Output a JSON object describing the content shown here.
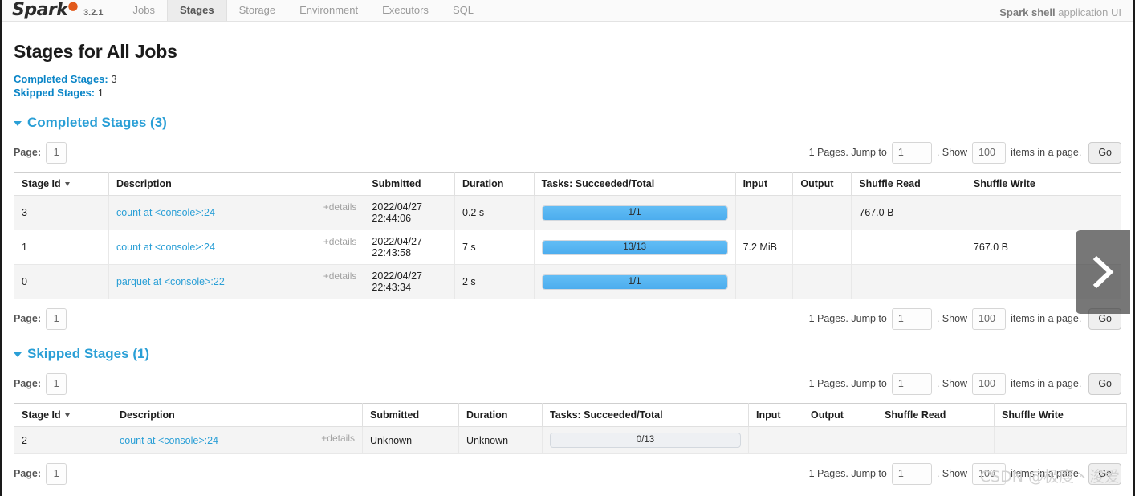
{
  "navbar": {
    "logo_text": "Spark",
    "version": "3.2.1",
    "tabs": [
      {
        "label": "Jobs",
        "active": false
      },
      {
        "label": "Stages",
        "active": true
      },
      {
        "label": "Storage",
        "active": false
      },
      {
        "label": "Environment",
        "active": false
      },
      {
        "label": "Executors",
        "active": false
      },
      {
        "label": "SQL",
        "active": false
      }
    ],
    "app_name": "Spark shell",
    "app_suffix": " application UI"
  },
  "page": {
    "title": "Stages for All Jobs",
    "completed_label": "Completed Stages:",
    "completed_count": "3",
    "skipped_label": "Skipped Stages:",
    "skipped_count": "1"
  },
  "sections": {
    "completed": {
      "heading": "Completed Stages (3)",
      "headers": [
        "Stage Id",
        "Description",
        "Submitted",
        "Duration",
        "Tasks: Succeeded/Total",
        "Input",
        "Output",
        "Shuffle Read",
        "Shuffle Write"
      ],
      "rows": [
        {
          "stage_id": "3",
          "description": "count at <console>:24",
          "details": "+details",
          "submitted": "2022/04/27 22:44:06",
          "duration": "0.2 s",
          "tasks_label": "1/1",
          "tasks_percent": 100,
          "input": "",
          "output": "",
          "shuffle_read": "767.0 B",
          "shuffle_write": ""
        },
        {
          "stage_id": "1",
          "description": "count at <console>:24",
          "details": "+details",
          "submitted": "2022/04/27 22:43:58",
          "duration": "7 s",
          "tasks_label": "13/13",
          "tasks_percent": 100,
          "input": "7.2 MiB",
          "output": "",
          "shuffle_read": "",
          "shuffle_write": "767.0 B"
        },
        {
          "stage_id": "0",
          "description": "parquet at <console>:22",
          "details": "+details",
          "submitted": "2022/04/27 22:43:34",
          "duration": "2 s",
          "tasks_label": "1/1",
          "tasks_percent": 100,
          "input": "",
          "output": "",
          "shuffle_read": "",
          "shuffle_write": ""
        }
      ]
    },
    "skipped": {
      "heading": "Skipped Stages (1)",
      "headers": [
        "Stage Id",
        "Description",
        "Submitted",
        "Duration",
        "Tasks: Succeeded/Total",
        "Input",
        "Output",
        "Shuffle Read",
        "Shuffle Write"
      ],
      "rows": [
        {
          "stage_id": "2",
          "description": "count at <console>:24",
          "details": "+details",
          "submitted": "Unknown",
          "duration": "Unknown",
          "tasks_label": "0/13",
          "tasks_percent": 0,
          "input": "",
          "output": "",
          "shuffle_read": "",
          "shuffle_write": ""
        }
      ]
    }
  },
  "pagination": {
    "page_label": "Page:",
    "page_value": "1",
    "pages_prefix": "1 Pages. Jump to",
    "jump_value": "1",
    "show_label": ". Show",
    "show_value": "100",
    "items_suffix": "items in a page.",
    "go_label": "Go"
  },
  "overlay": {
    "next_icon": "chevron-right-icon"
  },
  "watermark": "CSDN @极度丶浚爱",
  "colors": {
    "accent_blue": "#2a9fd6",
    "link_blue": "#0a85c7",
    "progress_fill": "#4cadee",
    "progress_track": "#eef0f3"
  }
}
